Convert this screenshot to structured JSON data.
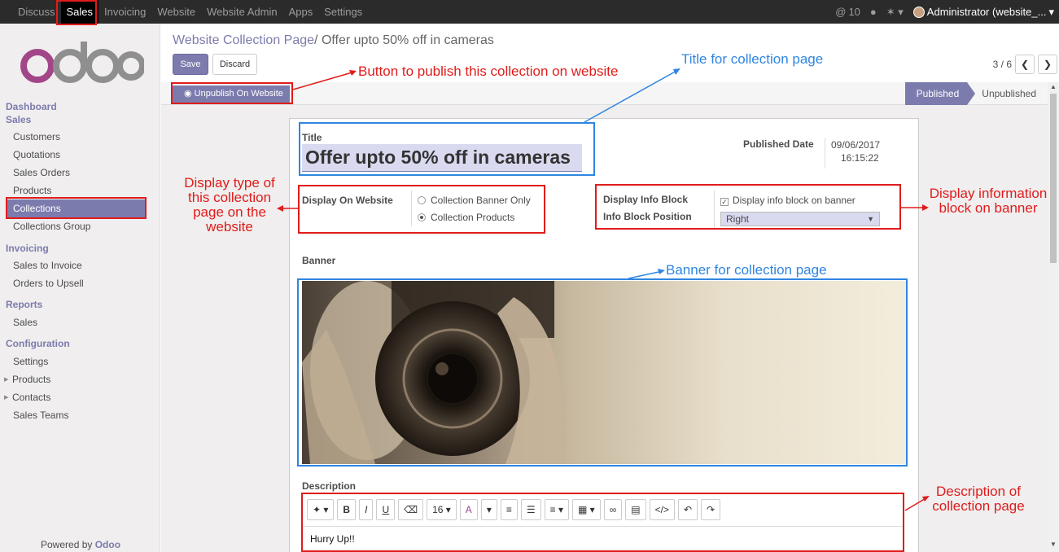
{
  "topbar": {
    "menu": [
      "Discuss",
      "Sales",
      "Invoicing",
      "Website",
      "Website Admin",
      "Apps",
      "Settings"
    ],
    "active_index": 1,
    "mentions": "10",
    "user": "Administrator (website_..."
  },
  "sidebar": {
    "logo_text": "odoo",
    "sections": [
      {
        "title": "Dashboard"
      },
      {
        "title": "Sales",
        "items": [
          "Customers",
          "Quotations",
          "Sales Orders",
          "Products",
          "Collections",
          "Collections Group"
        ]
      },
      {
        "title": "Invoicing",
        "items": [
          "Sales to Invoice",
          "Orders to Upsell"
        ]
      },
      {
        "title": "Reports",
        "items": [
          "Sales"
        ]
      },
      {
        "title": "Configuration",
        "items": [
          "Settings",
          "Products",
          "Contacts",
          "Sales Teams"
        ]
      }
    ],
    "active_item": "Collections",
    "powered_prefix": "Powered by",
    "powered_brand": "Odoo"
  },
  "control": {
    "breadcrumb_parent": "Website Collection Page",
    "breadcrumb_sep": "/",
    "breadcrumb_current": "Offer upto 50% off in cameras",
    "save_label": "Save",
    "discard_label": "Discard",
    "pager": "3 / 6"
  },
  "statusbar": {
    "publish_label": "Unpublish On Website",
    "stage_on": "Published",
    "stage_off": "Unpublished"
  },
  "form": {
    "title_label": "Title",
    "title_value": "Offer upto 50% off in cameras",
    "published_label": "Published Date",
    "published_date": "09/06/2017",
    "published_time": "16:15:22",
    "display_label": "Display On Website",
    "display_options": [
      "Collection Banner Only",
      "Collection Products"
    ],
    "display_selected": 1,
    "info_block_label": "Display Info Block",
    "info_block_check": "Display info block on banner",
    "info_position_label": "Info Block Position",
    "info_position_value": "Right",
    "banner_label": "Banner",
    "description_label": "Description",
    "font_size": "16",
    "description_text": "Hurry Up!!"
  },
  "annotations": {
    "publish": "Button to publish this collection on website",
    "title": "Title for collection page",
    "display_type": "Display type of this collection page on the website",
    "info_block": "Display information block on banner",
    "banner": "Banner for collection page",
    "description": "Description of collection page"
  },
  "colors": {
    "accent": "#7c7bad",
    "annotation_red": "#e01c1c",
    "annotation_blue": "#2f86e0"
  }
}
